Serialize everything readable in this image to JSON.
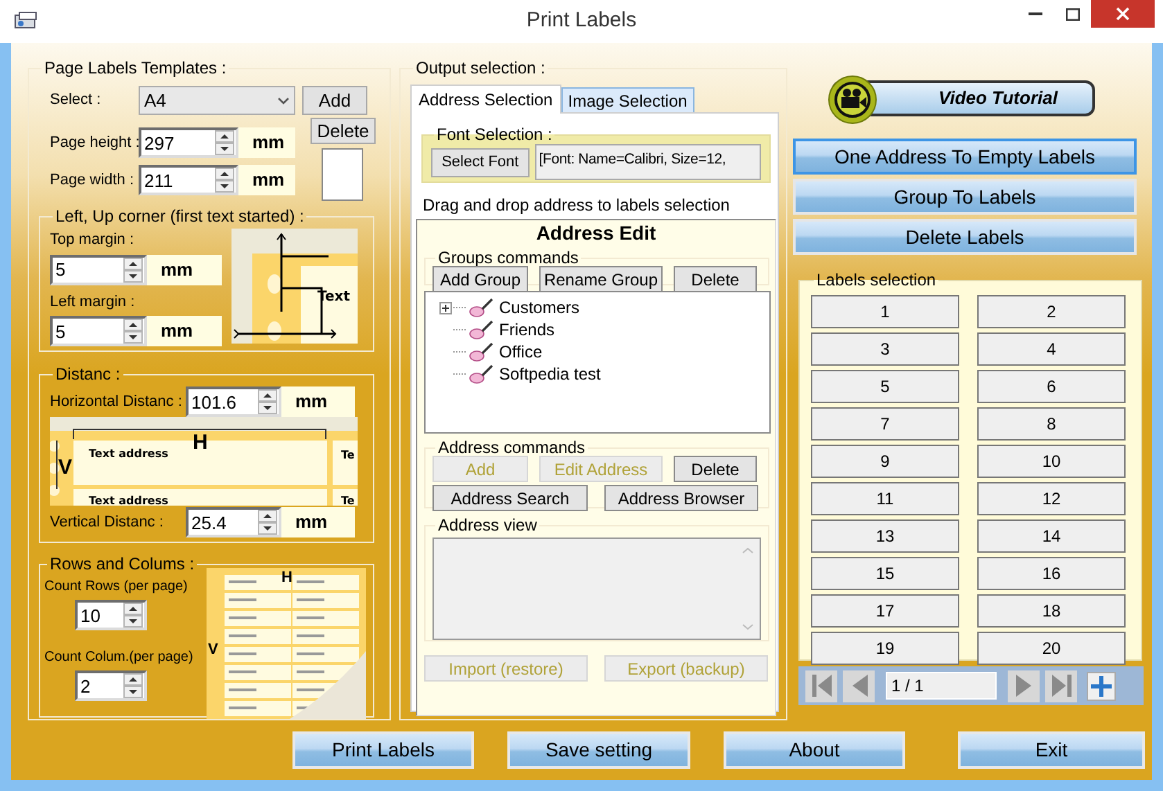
{
  "window": {
    "title": "Print Labels"
  },
  "templates": {
    "title": "Page Labels Templates :",
    "select_label": "Select :",
    "select_value": "A4",
    "add": "Add",
    "delete": "Delete",
    "page_fields": [
      {
        "label": "Page height :",
        "value": "297",
        "unit": "mm"
      },
      {
        "label": "Page width :",
        "value": "211",
        "unit": "mm"
      }
    ],
    "corner": {
      "title": "Left, Up corner (first text started) :",
      "fields": [
        {
          "label": "Top margin :",
          "value": "5",
          "unit": "mm"
        },
        {
          "label": "Left margin  :",
          "value": "5",
          "unit": "mm"
        }
      ],
      "diagram_text": "Text"
    },
    "distance": {
      "title": "Distanc :",
      "horizontal": {
        "label": "Horizontal Distanc :",
        "value": "101.6",
        "unit": "mm"
      },
      "vertical": {
        "label": "Vertical Distanc :",
        "value": "25.4",
        "unit": "mm"
      },
      "diagram_texts": [
        "H",
        "V",
        "Text address",
        "Text address",
        "Te",
        "Te"
      ]
    },
    "rows": {
      "title": "Rows and Colums :",
      "fields": [
        {
          "label": "Count Rows (per page)",
          "value": "10"
        },
        {
          "label": "Count Colum.(per page)",
          "value": "2"
        }
      ],
      "diagram_texts": [
        "H",
        "V"
      ]
    }
  },
  "output": {
    "title": "Output selection :",
    "tabs": [
      {
        "label": "Address Selection",
        "selected": true
      },
      {
        "label": "Image Selection",
        "selected": false
      }
    ],
    "font": {
      "title": "Font Selection :",
      "button": "Select Font",
      "value": "[Font: Name=Calibri, Size=12,"
    },
    "hint": "Drag and drop address to labels selection",
    "editor": {
      "title": "Address Edit",
      "groups_title": "Groups commands",
      "group_buttons": [
        {
          "label": "Add Group",
          "disabled": false
        },
        {
          "label": "Rename Group",
          "disabled": false
        },
        {
          "label": "Delete",
          "disabled": false
        }
      ],
      "tree": [
        {
          "label": "Customers",
          "kind": "collapsed"
        },
        {
          "label": "Friends",
          "kind": "leaf"
        },
        {
          "label": "Office",
          "kind": "leaf"
        },
        {
          "label": "Softpedia test",
          "kind": "leaf"
        }
      ],
      "address_title": "Address commands",
      "address_buttons": [
        {
          "label": "Add",
          "disabled": true
        },
        {
          "label": "Edit Address",
          "disabled": true
        },
        {
          "label": "Delete",
          "disabled": false
        },
        {
          "label": "Address Search",
          "disabled": false
        },
        {
          "label": "Address Browser",
          "disabled": false
        }
      ],
      "view_title": "Address view",
      "backup_buttons": [
        {
          "label": "Import (restore)",
          "disabled": true
        },
        {
          "label": "Export (backup)",
          "disabled": true
        }
      ]
    }
  },
  "right": {
    "video": "Video Tutorial",
    "actions": [
      {
        "label": "One Address To Empty Labels",
        "focused": true
      },
      {
        "label": "Group To Labels",
        "focused": false
      },
      {
        "label": "Delete Labels",
        "focused": false
      }
    ],
    "labels_title": "Labels selection",
    "labels": [
      "1",
      "2",
      "3",
      "4",
      "5",
      "6",
      "7",
      "8",
      "9",
      "10",
      "11",
      "12",
      "13",
      "14",
      "15",
      "16",
      "17",
      "18",
      "19",
      "20"
    ],
    "page": "1 / 1"
  },
  "bottom_buttons": [
    "Print Labels",
    "Save setting",
    "About",
    "Exit"
  ]
}
